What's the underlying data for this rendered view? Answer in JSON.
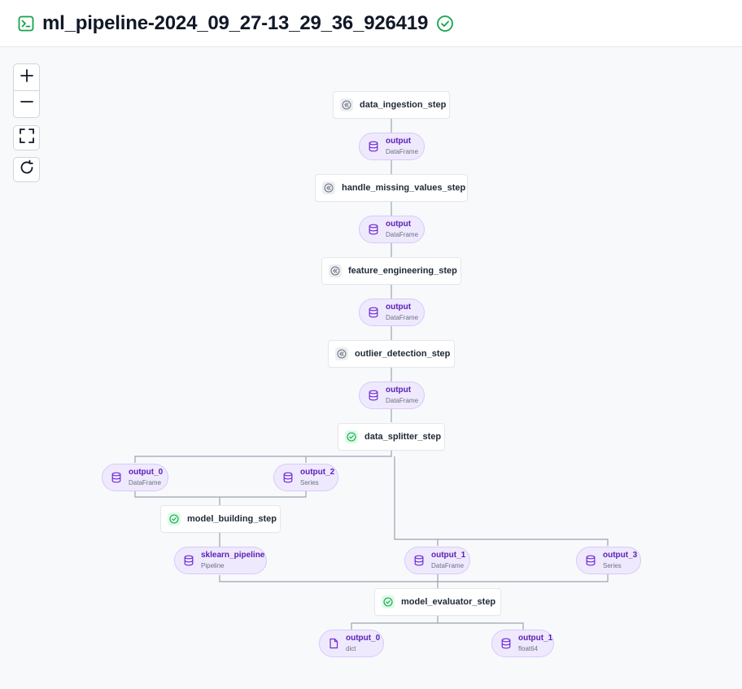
{
  "header": {
    "title": "ml_pipeline-2024_09_27-13_29_36_926419",
    "status": "completed"
  },
  "colors": {
    "accent_green": "#16a34a",
    "artifact_bg": "#efe9fd",
    "artifact_border": "#d8c9fb",
    "artifact_text": "#5b21b6",
    "edge": "#9ca3af"
  },
  "controls": [
    "zoom-in-icon",
    "zoom-out-icon",
    "fit-view-icon",
    "refresh-icon"
  ],
  "steps": {
    "data_ingestion": {
      "label": "data_ingestion_step",
      "status": "cached"
    },
    "handle_missing_values": {
      "label": "handle_missing_values_step",
      "status": "cached"
    },
    "feature_engineering": {
      "label": "feature_engineering_step",
      "status": "cached"
    },
    "outlier_detection": {
      "label": "outlier_detection_step",
      "status": "cached"
    },
    "data_splitter": {
      "label": "data_splitter_step",
      "status": "completed"
    },
    "model_building": {
      "label": "model_building_step",
      "status": "completed"
    },
    "model_evaluator": {
      "label": "model_evaluator_step",
      "status": "completed"
    }
  },
  "artifacts": {
    "ingestion_output": {
      "name": "output",
      "type": "DataFrame"
    },
    "missing_output": {
      "name": "output",
      "type": "DataFrame"
    },
    "feature_output": {
      "name": "output",
      "type": "DataFrame"
    },
    "outlier_output": {
      "name": "output",
      "type": "DataFrame"
    },
    "split_output_0": {
      "name": "output_0",
      "type": "DataFrame"
    },
    "split_output_2": {
      "name": "output_2",
      "type": "Series"
    },
    "split_output_1": {
      "name": "output_1",
      "type": "DataFrame"
    },
    "split_output_3": {
      "name": "output_3",
      "type": "Series"
    },
    "sklearn_pipeline": {
      "name": "sklearn_pipeline",
      "type": "Pipeline"
    },
    "eval_output_0": {
      "name": "output_0",
      "type": "dict"
    },
    "eval_output_1": {
      "name": "output_1",
      "type": "float64"
    }
  }
}
